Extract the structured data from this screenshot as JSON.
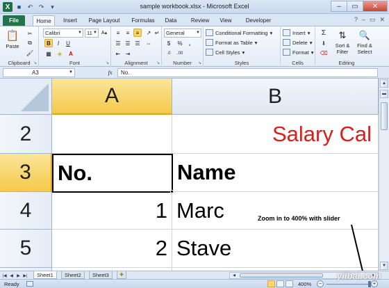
{
  "window": {
    "title": "sample workbook.xlsx - Microsoft Excel",
    "controls": {
      "minimize": "–",
      "maximize": "▭",
      "close": "✕"
    }
  },
  "quick_access": {
    "app_icon": "X",
    "save_icon": "💾",
    "undo_icon": "↶",
    "redo_icon": "↷",
    "customize_icon": "▾"
  },
  "ribbon_tabs": [
    "File",
    "Home",
    "Insert",
    "Page Layout",
    "Formulas",
    "Data",
    "Review",
    "View",
    "Developer"
  ],
  "active_tab": "Home",
  "ribbon_right": {
    "help": "?",
    "min": "–",
    "restore": "▭",
    "close": "✕"
  },
  "ribbon": {
    "clipboard": {
      "label": "Clipboard",
      "paste": "Paste"
    },
    "font": {
      "label": "Font",
      "font_name": "Calibri",
      "font_size": "11",
      "bold": "B",
      "italic": "I",
      "underline": "U",
      "grow": "A▴",
      "shrink": "A▾"
    },
    "alignment": {
      "label": "Alignment"
    },
    "number": {
      "label": "Number",
      "format": "General",
      "currency": "$",
      "percent": "%",
      "comma": ",",
      "inc_dec": ".0",
      "dec_dec": ".00"
    },
    "styles": {
      "label": "Styles",
      "conditional": "Conditional Formatting",
      "format_table": "Format as Table",
      "cell_styles": "Cell Styles"
    },
    "cells": {
      "label": "Cells",
      "insert": "Insert",
      "delete": "Delete",
      "format": "Format"
    },
    "editing": {
      "label": "Editing",
      "sum": "Σ",
      "sort_filter_1": "Sort &",
      "sort_filter_2": "Filter",
      "find_select_1": "Find &",
      "find_select_2": "Select"
    }
  },
  "formula_bar": {
    "name_box": "A3",
    "fx": "fx",
    "content": "No."
  },
  "grid": {
    "columns": [
      "A",
      "B"
    ],
    "rows": [
      {
        "num": "2",
        "a": "",
        "b": "Salary Cal"
      },
      {
        "num": "3",
        "a": "No.",
        "b": "Name"
      },
      {
        "num": "4",
        "a": "1",
        "b": "Marc"
      },
      {
        "num": "5",
        "a": "2",
        "b": "Stave"
      }
    ]
  },
  "annotation": "Zoom in to 400% with slider",
  "sheets": [
    "Sheet1",
    "Sheet2",
    "Sheet3"
  ],
  "active_sheet": "Sheet1",
  "status": {
    "mode": "Ready",
    "zoom": "400%",
    "zoom_fraction": 1.0
  },
  "watermark": "yiibai.com",
  "colors": {
    "file_tab": "#20744a",
    "selection_header": "#f5c94a",
    "red_text": "#e01b1b"
  }
}
